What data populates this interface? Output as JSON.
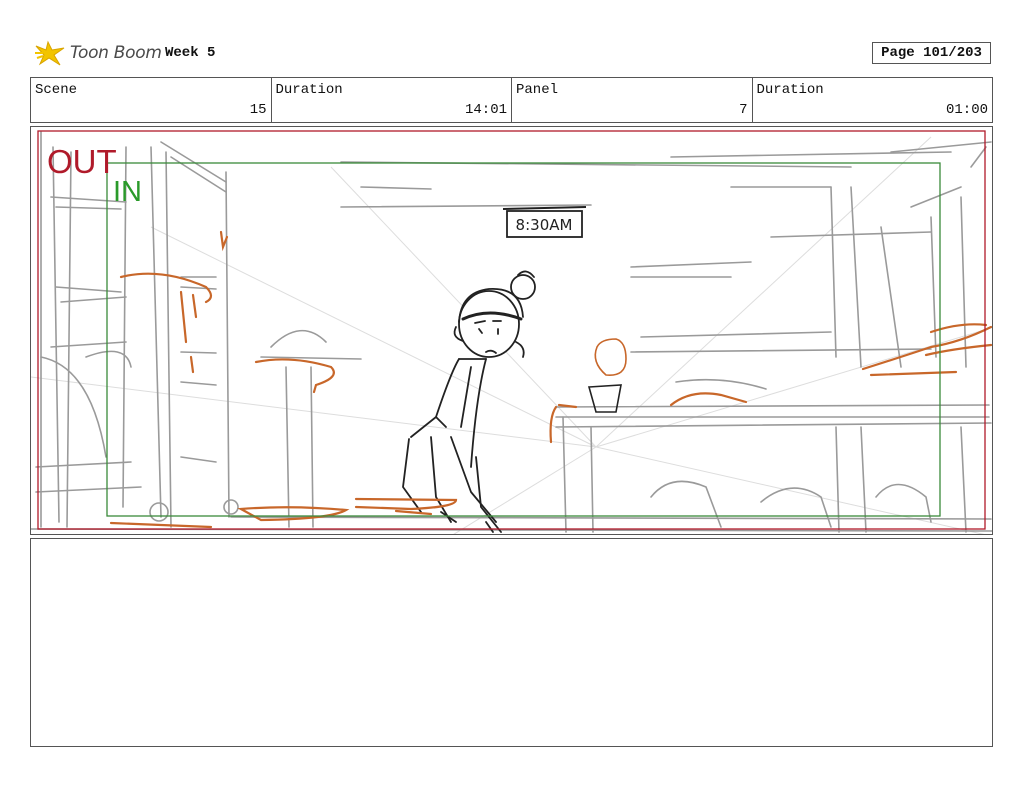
{
  "header": {
    "logo_text": "Toon Boom",
    "project_title": "Week 5",
    "page_label": "Page 101/203"
  },
  "info_bar": [
    {
      "label": "Scene",
      "value": "15"
    },
    {
      "label": "Duration",
      "value": "14:01"
    },
    {
      "label": "Panel",
      "value": "7"
    },
    {
      "label": "Duration",
      "value": "01:00"
    }
  ],
  "panel": {
    "out_label": "OUT",
    "in_label": "IN",
    "clock_text": "8:30AM"
  },
  "colors": {
    "out_frame": "#b01a2a",
    "in_frame": "#3a8a3a",
    "sketch_gray": "#9a9a9a",
    "sketch_orange": "#c8672a"
  },
  "notes": {
    "text": ""
  }
}
